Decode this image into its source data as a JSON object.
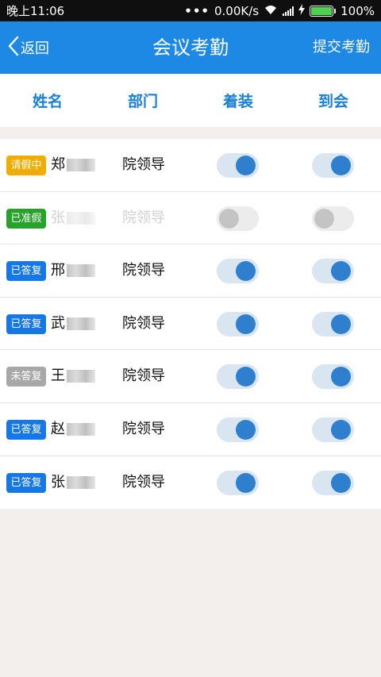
{
  "status_bar": {
    "time": "晚上11:06",
    "network_speed": "0.00K/s",
    "battery": "100%",
    "icons": [
      "dots-icon",
      "wifi-icon",
      "signal-icon",
      "charging-icon",
      "battery-icon"
    ]
  },
  "nav": {
    "back_label": "返回",
    "title": "会议考勤",
    "submit_label": "提交考勤"
  },
  "columns": [
    "姓名",
    "部门",
    "着装",
    "到会"
  ],
  "rows": [
    {
      "badge": "请假中",
      "badge_color": "#f0ad00",
      "name": "郑",
      "dept": "院领导",
      "dress_on": true,
      "attend_on": true,
      "dim": false
    },
    {
      "badge": "已准假",
      "badge_color": "#27a22b",
      "name": "张",
      "dept": "院领导",
      "dress_on": false,
      "attend_on": false,
      "dim": true
    },
    {
      "badge": "已答复",
      "badge_color": "#1678e8",
      "name": "邢",
      "dept": "院领导",
      "dress_on": true,
      "attend_on": true,
      "dim": false
    },
    {
      "badge": "已答复",
      "badge_color": "#1678e8",
      "name": "武",
      "dept": "院领导",
      "dress_on": true,
      "attend_on": true,
      "dim": false
    },
    {
      "badge": "未答复",
      "badge_color": "#a8a8a8",
      "name": "王",
      "dept": "院领导",
      "dress_on": true,
      "attend_on": true,
      "dim": false
    },
    {
      "badge": "已答复",
      "badge_color": "#1678e8",
      "name": "赵",
      "dept": "院领导",
      "dress_on": true,
      "attend_on": true,
      "dim": false
    },
    {
      "badge": "已答复",
      "badge_color": "#1678e8",
      "name": "张",
      "dept": "院领导",
      "dress_on": true,
      "attend_on": true,
      "dim": false
    }
  ],
  "colors": {
    "nav_bg": "#1e88e5",
    "header_text": "#1a7fd6",
    "toggle_knob_on": "#2f7fcf",
    "toggle_track_on": "#d9e6f2",
    "page_bg": "#f2efec"
  }
}
